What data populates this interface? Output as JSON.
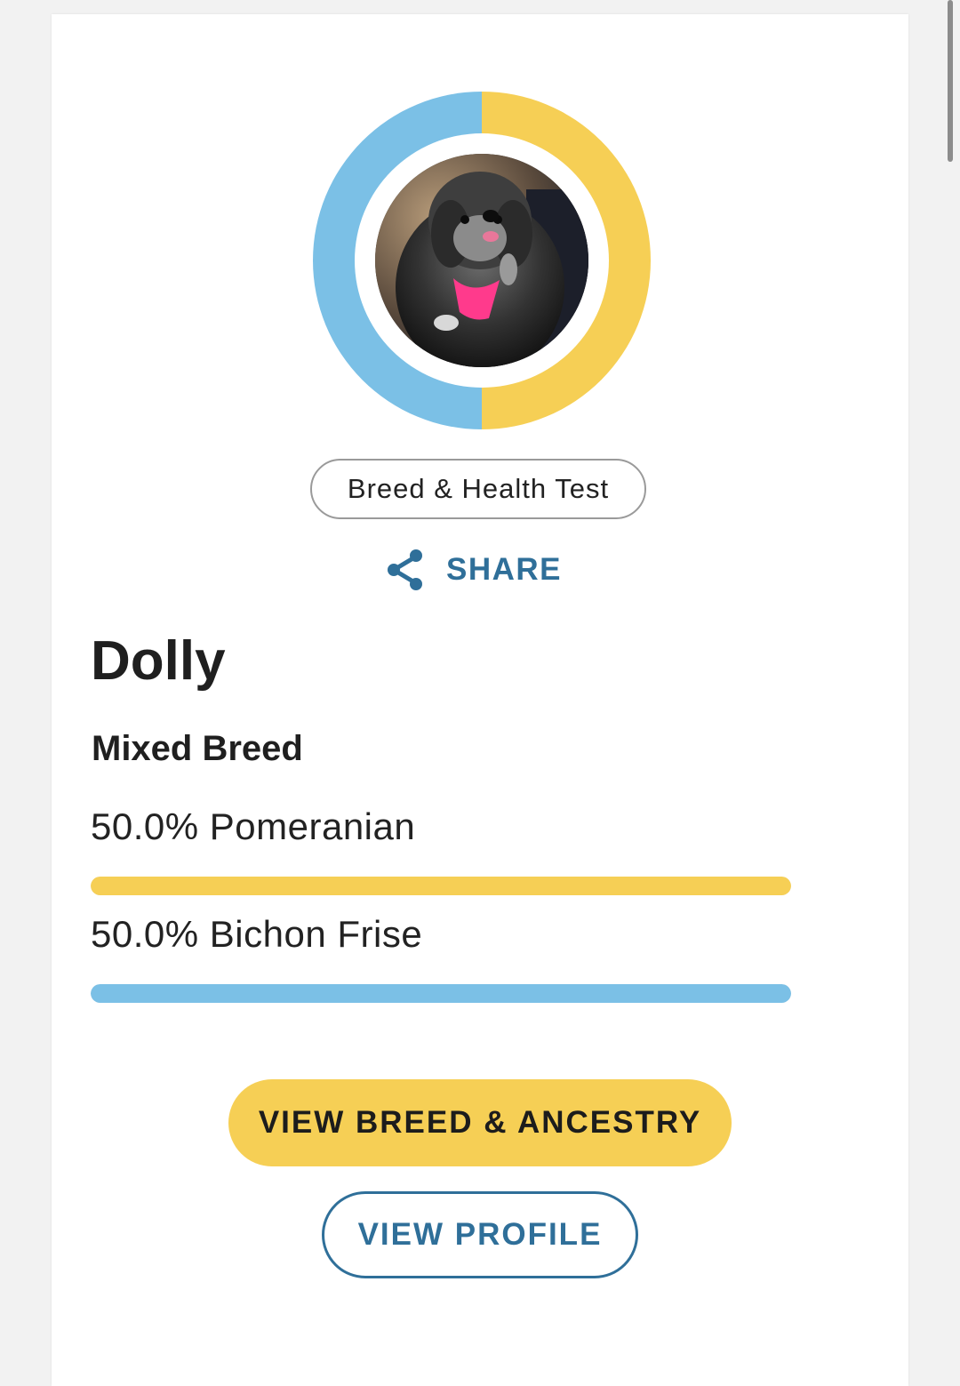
{
  "colors": {
    "primary_breed": "#f6cf55",
    "secondary_breed": "#7bc0e6",
    "accent_blue": "#2f6f99"
  },
  "profile": {
    "avatar_alt": "dog-photo",
    "test_badge": "Breed & Health Test",
    "share_label": "SHARE",
    "share_icon": "share-icon",
    "name": "Dolly",
    "breed_type": "Mixed Breed"
  },
  "breeds": [
    {
      "label": "50.0% Pomeranian",
      "percent": 50.0,
      "color": "#f6cf55"
    },
    {
      "label": "50.0% Bichon Frise",
      "percent": 50.0,
      "color": "#7bc0e6"
    }
  ],
  "actions": {
    "view_breed_label": "VIEW BREED & ANCESTRY",
    "view_profile_label": "VIEW PROFILE"
  }
}
